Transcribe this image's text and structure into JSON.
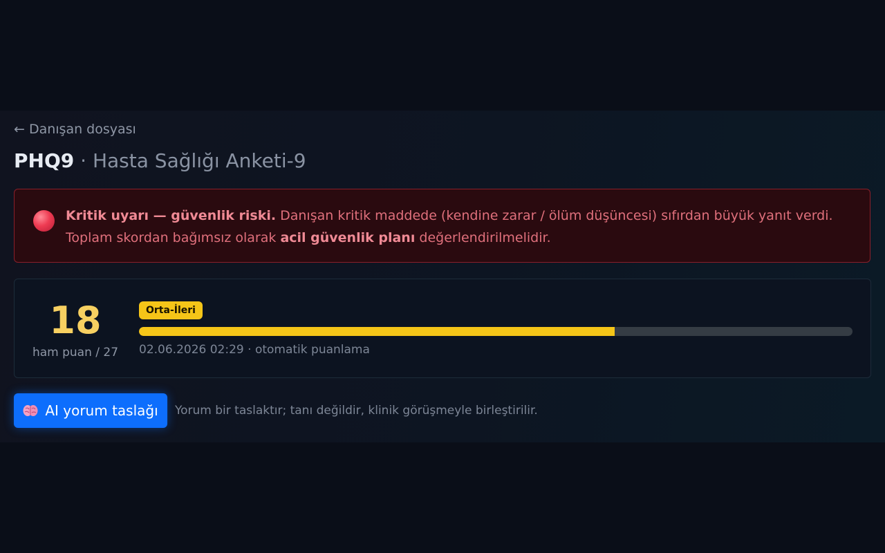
{
  "header": {
    "back_label": "← Danışan dosyası",
    "test_code": "PHQ9",
    "title_separator": " · ",
    "test_name": "Hasta Sağlığı Anketi-9"
  },
  "alert": {
    "icon": "red-circle-icon",
    "bold_title": "Kritik uyarı — güvenlik riski.",
    "text_part1": " Danışan kritik maddede (kendine zarar / ölüm düşüncesi) sıfırdan büyük yanıt verdi. Toplam skordan bağımsız olarak ",
    "bold_emphasis": "acil güvenlik planı",
    "text_part2": " değerlendirilmelidir.",
    "color": "#e0707c"
  },
  "score": {
    "value": "18",
    "caption": "ham puan / 27",
    "raw": 18,
    "max": 27,
    "severity_label": "Orta-İleri",
    "severity_color": "#f5c518",
    "meta": "02.06.2026 02:29 · otomatik puanlama"
  },
  "ai": {
    "icon": "brain-icon",
    "button_label": "AI yorum taslağı",
    "note": "Yorum bir taslaktır; tanı değildir, klinik görüşmeyle birleştirilir."
  },
  "colors": {
    "accent": "#0d6efd",
    "background": "#0a0e18"
  }
}
